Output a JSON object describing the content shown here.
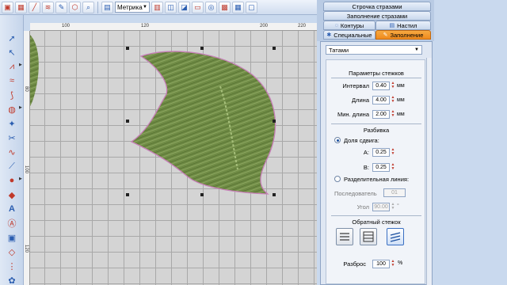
{
  "toolbar": {
    "units_value": "Метрика",
    "icons": [
      "new-icon",
      "fill-pattern-icon",
      "brush-icon",
      "stitch-icon",
      "pencil-icon",
      "shape-icon",
      "zoom-icon"
    ]
  },
  "rulers": {
    "top": [
      "100",
      "120",
      "200",
      "220"
    ],
    "left": [
      "80",
      "100",
      "120"
    ]
  },
  "tabs": {
    "row1": "Строчка стразами",
    "row2": "Заполнение стразами",
    "contours": "Контуры",
    "nastil": "Настил",
    "special": "Специальные",
    "fill": "Заполнение"
  },
  "panel": {
    "fill_type": "Татами",
    "stitch_params_title": "Параметры стежков",
    "interval_label": "Интервал",
    "interval_value": "0.40",
    "length_label": "Длина",
    "length_value": "4.00",
    "min_length_label": "Мин. длина",
    "min_length_value": "2.00",
    "unit_mm": "мм",
    "split_title": "Разбивка",
    "shift_share_label": "Доля сдвига:",
    "a_label": "A:",
    "a_value": "0.25",
    "b_label": "B:",
    "b_value": "0.25",
    "dividing_line_label": "Разделительная линия:",
    "sequence_label": "Последователь",
    "sequence_value": "01",
    "angle_label": "Угол",
    "angle_value": "90.00",
    "angle_unit": "°",
    "reverse_title": "Обратный стежок",
    "spread_label": "Разброс",
    "spread_value": "100",
    "spread_unit": "%"
  },
  "colors": {
    "active_tab": "#f08a1c",
    "stitch_fill": "#6f8b45",
    "outline": "#c77fb8"
  }
}
